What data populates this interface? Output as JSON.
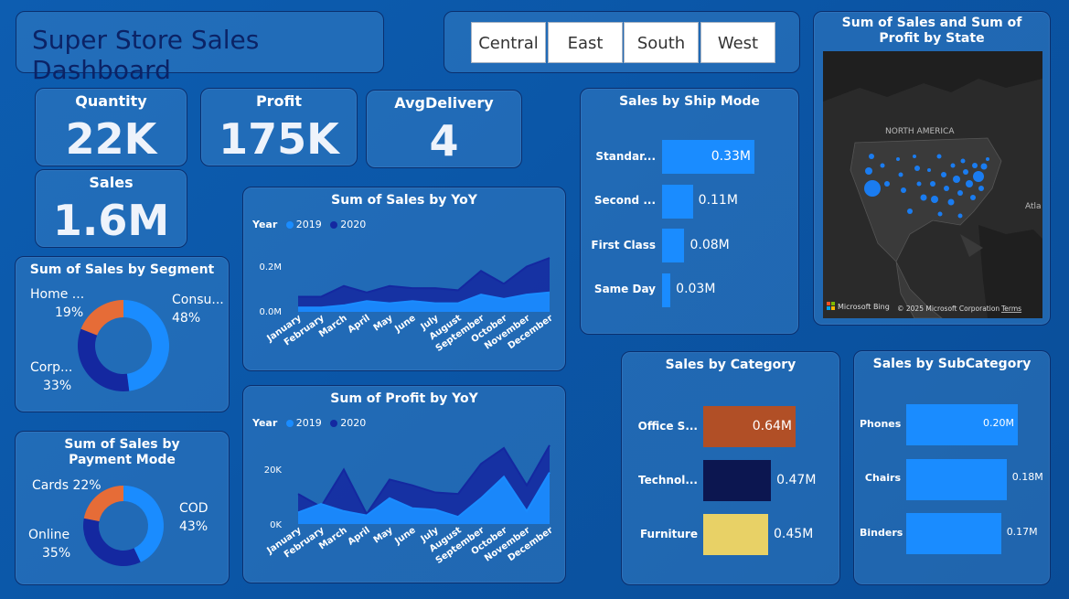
{
  "title": "Super Store Sales Dashboard",
  "regions": [
    "Central",
    "East",
    "South",
    "West"
  ],
  "kpis": {
    "quantity": {
      "label": "Quantity",
      "value": "22K"
    },
    "profit": {
      "label": "Profit",
      "value": "175K"
    },
    "avg_delivery": {
      "label": "AvgDelivery",
      "value": "4"
    },
    "sales": {
      "label": "Sales",
      "value": "1.6M"
    }
  },
  "ship_mode": {
    "title": "Sales by Ship Mode",
    "chart_data": {
      "type": "bar",
      "categories": [
        "Standar...",
        "Second ...",
        "First Class",
        "Same Day"
      ],
      "values": [
        0.33,
        0.11,
        0.08,
        0.03
      ],
      "labels": [
        "0.33M",
        "0.11M",
        "0.08M",
        "0.03M"
      ],
      "color": "#1a8cff"
    }
  },
  "map": {
    "title": "Sum of Sales and Sum of Profit by State",
    "region_label": "NORTH AMERICA",
    "side_label": "Atla",
    "bing": "Microsoft Bing",
    "copyright": "© 2025 Microsoft Corporation",
    "terms": "Terms"
  },
  "segment": {
    "title": "Sum of Sales by Segment",
    "chart_data": {
      "type": "pie",
      "labels": [
        "Consu...",
        "Corp...",
        "Home ..."
      ],
      "values": [
        48,
        33,
        19
      ],
      "value_labels": [
        "48%",
        "33%",
        "19%"
      ],
      "colors": [
        "#1a8cff",
        "#1428a0",
        "#e66c37"
      ]
    }
  },
  "payment": {
    "title": "Sum of Sales by Payment Mode",
    "chart_data": {
      "type": "pie",
      "labels": [
        "COD",
        "Online",
        "Cards"
      ],
      "values": [
        43,
        35,
        22
      ],
      "value_labels": [
        "43%",
        "35%",
        "22%"
      ],
      "colors": [
        "#1a8cff",
        "#1428a0",
        "#e66c37"
      ]
    }
  },
  "sales_yoy": {
    "title": "Sum of Sales by YoY",
    "legend_title": "Year",
    "chart_data": {
      "type": "area",
      "x": [
        "January",
        "February",
        "March",
        "April",
        "May",
        "June",
        "July",
        "August",
        "September",
        "October",
        "November",
        "December"
      ],
      "series": [
        {
          "name": "2019",
          "values": [
            0.02,
            0.02,
            0.03,
            0.05,
            0.04,
            0.05,
            0.04,
            0.04,
            0.08,
            0.06,
            0.08,
            0.09
          ],
          "color": "#1a8cff"
        },
        {
          "name": "2020",
          "values": [
            0.07,
            0.07,
            0.12,
            0.09,
            0.12,
            0.11,
            0.11,
            0.1,
            0.19,
            0.13,
            0.21,
            0.25
          ],
          "color": "#1428a0"
        }
      ],
      "ytick_labels": [
        "0.0M",
        "0.2M"
      ],
      "ylim": [
        0,
        0.28
      ]
    }
  },
  "profit_yoy": {
    "title": "Sum of Profit by YoY",
    "legend_title": "Year",
    "chart_data": {
      "type": "area",
      "x": [
        "January",
        "February",
        "March",
        "April",
        "May",
        "June",
        "July",
        "August",
        "September",
        "October",
        "November",
        "December"
      ],
      "series": [
        {
          "name": "2019",
          "values": [
            4000,
            7000,
            4500,
            3000,
            9000,
            5500,
            5000,
            2500,
            9000,
            16500,
            4500,
            18000
          ],
          "color": "#1a8cff"
        },
        {
          "name": "2020",
          "values": [
            10500,
            6000,
            19000,
            3500,
            15500,
            13500,
            11000,
            10500,
            21000,
            26500,
            13500,
            27500
          ],
          "color": "#1428a0"
        }
      ],
      "ytick_labels": [
        "0K",
        "20K"
      ],
      "ylim": [
        0,
        30000
      ]
    }
  },
  "category": {
    "title": "Sales by Category",
    "chart_data": {
      "type": "bar",
      "categories": [
        "Office S...",
        "Technol...",
        "Furniture"
      ],
      "values": [
        0.64,
        0.47,
        0.45
      ],
      "labels": [
        "0.64M",
        "0.47M",
        "0.45M"
      ],
      "colors": [
        "#b14f26",
        "#0c1650",
        "#e8d166"
      ]
    }
  },
  "subcategory": {
    "title": "Sales by SubCategory",
    "chart_data": {
      "type": "bar",
      "categories": [
        "Phones",
        "Chairs",
        "Binders"
      ],
      "values": [
        0.2,
        0.18,
        0.17
      ],
      "labels": [
        "0.20M",
        "0.18M",
        "0.17M"
      ],
      "color": "#1a8cff"
    }
  }
}
